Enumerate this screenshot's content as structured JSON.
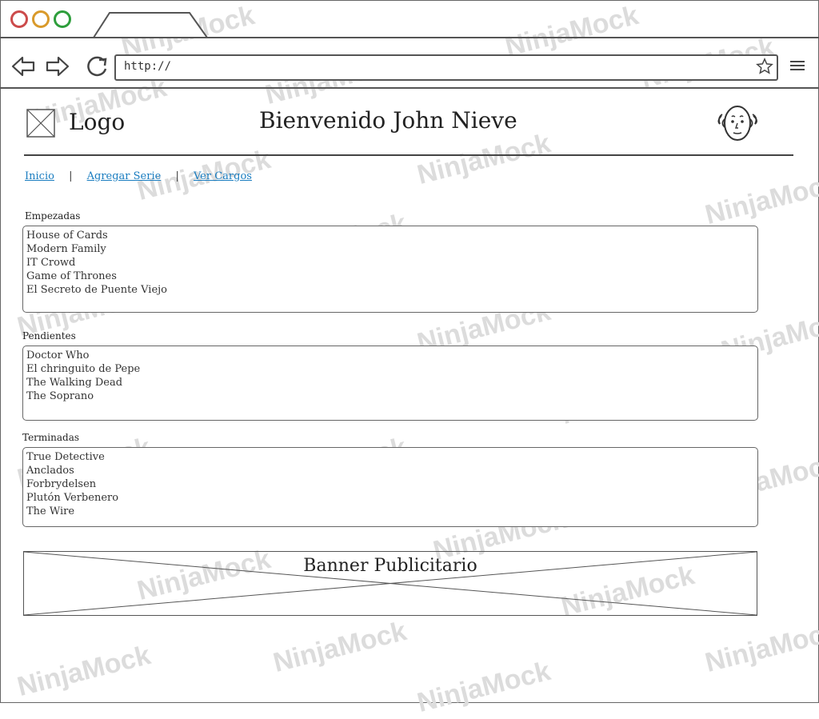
{
  "browser": {
    "url": "http://",
    "controls": [
      "back-icon",
      "forward-icon",
      "reload-icon"
    ],
    "traffic_lights": [
      "#cc4b4b",
      "#d99a2b",
      "#2e9e3c"
    ]
  },
  "header": {
    "logo_label": "Logo",
    "welcome": "Bienvenido John Nieve"
  },
  "nav": {
    "items": [
      "Inicio",
      "Agregar Serie",
      "Ver Cargos"
    ],
    "separator": "|",
    "link_color": "#1a7dc0"
  },
  "sections": [
    {
      "label": "Empezadas",
      "items": [
        "House of Cards",
        "Modern Family",
        "IT Crowd",
        "Game of Thrones",
        "El Secreto de Puente Viejo"
      ]
    },
    {
      "label": "Pendientes",
      "items": [
        "Doctor Who",
        "El chringuito de Pepe",
        "The Walking Dead",
        "The Soprano"
      ]
    },
    {
      "label": "Terminadas",
      "items": [
        "True Detective",
        "Anclados",
        "Forbrydelsen",
        "Plutón Verbenero",
        "The Wire"
      ]
    }
  ],
  "banner": {
    "label": "Banner Publicitario"
  },
  "watermark": "NinjaMock"
}
